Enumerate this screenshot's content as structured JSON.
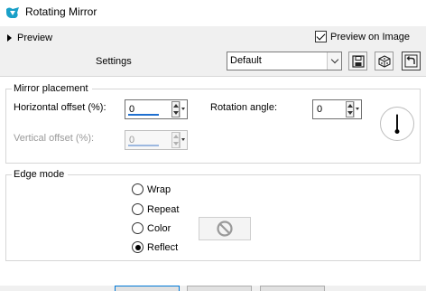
{
  "window": {
    "title": "Rotating Mirror",
    "icon": "app-logo-icon"
  },
  "preview_bar": {
    "toggle_label": "Preview",
    "preview_on_image_label": "Preview on Image",
    "preview_on_image_checked": true
  },
  "settings": {
    "label": "Settings",
    "preset_value": "Default",
    "buttons": [
      {
        "name": "save-preset-button",
        "icon": "floppy-disk-icon"
      },
      {
        "name": "randomize-button",
        "icon": "dice-icon"
      },
      {
        "name": "reset-button",
        "icon": "undo-icon"
      }
    ]
  },
  "mirror_placement": {
    "group_label": "Mirror placement",
    "horizontal_offset": {
      "label": "Horizontal offset (%):",
      "value": "0",
      "enabled": true
    },
    "vertical_offset": {
      "label": "Vertical offset (%):",
      "value": "0",
      "enabled": false
    },
    "rotation_angle": {
      "label": "Rotation angle:",
      "value": "0",
      "dial_icon": "angle-dial-icon"
    }
  },
  "edge_mode": {
    "group_label": "Edge mode",
    "options": [
      {
        "label": "Wrap",
        "checked": false
      },
      {
        "label": "Repeat",
        "checked": false
      },
      {
        "label": "Color",
        "checked": false
      },
      {
        "label": "Reflect",
        "checked": true
      }
    ],
    "color_swatch_icon": "no-color-icon"
  },
  "colors": {
    "accent": "#1e6fd0",
    "panel_bg": "#ffffff",
    "chrome_bg": "#f0f0f0",
    "titlebar_icon": "#1aa0c8"
  }
}
